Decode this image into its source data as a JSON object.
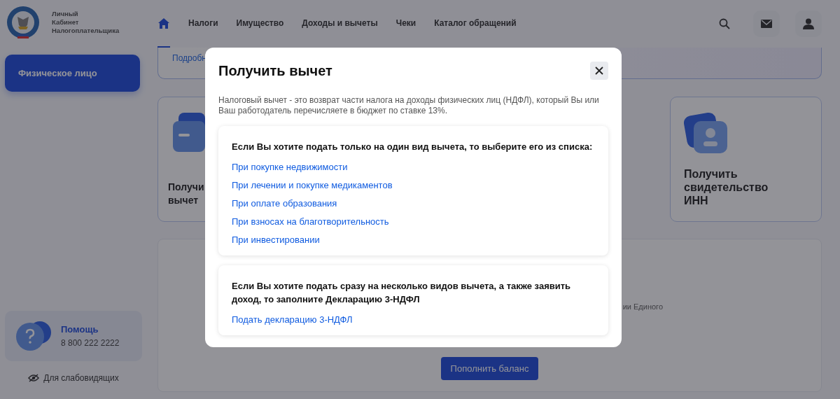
{
  "header": {
    "logo_lines": [
      "Личный",
      "Кабинет",
      "Налогоплательщика"
    ],
    "nav": [
      {
        "kind": "home",
        "selected": true
      },
      {
        "kind": "text",
        "label": "Налоги",
        "selected": false
      },
      {
        "kind": "text",
        "label": "Имущество",
        "selected": false
      },
      {
        "kind": "text",
        "label": "Доходы и вычеты",
        "selected": false
      },
      {
        "kind": "text",
        "label": "Чеки",
        "selected": false
      },
      {
        "kind": "text",
        "label": "Каталог обращений",
        "selected": false
      }
    ]
  },
  "sidebar": {
    "account": "Физическое лицо",
    "help": {
      "title": "Помощь",
      "phone": "8 800 222 2222"
    },
    "accessibility": "Для слабовидящих"
  },
  "main": {
    "banner_link": "Подробн",
    "cards": [
      {
        "kind": "card",
        "title_lines": [
          "Получи",
          "вычет"
        ]
      },
      {
        "kind": "person",
        "title_lines": [
          "Получить",
          "свидетельство",
          "ИНН"
        ]
      }
    ],
    "balance": {
      "text_fragment": "ии Единого",
      "button": "Пополнить баланс"
    }
  },
  "modal": {
    "title": "Получить вычет",
    "description": "Налоговый вычет - это возврат части налога на доходы физических лиц (НДФЛ), который Вы или Ваш работодатель перечисляете в бюджет по ставке 13%.",
    "sections": [
      {
        "heading": "Если Вы хотите подать только на один вид вычета, то выберите его из списка:",
        "links": [
          "При покупке недвижимости",
          "При лечении и покупке медикаментов",
          "При оплате образования",
          "При взносах на благотворительность",
          "При инвестировании"
        ]
      },
      {
        "heading": "Если Вы хотите подать сразу на несколько видов вычета, а также заявить доход, то заполните Декларацию 3-НДФЛ",
        "links": [
          "Подать декларацию 3-НДФЛ"
        ]
      }
    ]
  }
}
